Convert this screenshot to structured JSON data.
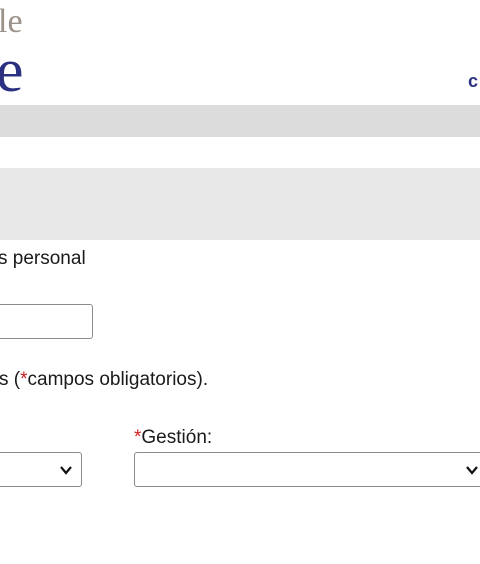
{
  "logo": {
    "line1": "le",
    "line2": "e"
  },
  "header": {
    "link_text": "c"
  },
  "form": {
    "section_label": "s personal",
    "input_value": "",
    "note_prefix": "s (",
    "note_asterisk": "*",
    "note_text": "campos obligatorios).",
    "gestion": {
      "asterisk": "*",
      "label": "Gestión:",
      "selected": ""
    },
    "left_select": {
      "selected": ""
    }
  },
  "colors": {
    "brand_navy": "#2b3080",
    "logo_gray": "#9b9389",
    "required_red": "#cc1f1f",
    "nav_bar": "#dcdcdc",
    "banner": "#e8e8e8"
  }
}
